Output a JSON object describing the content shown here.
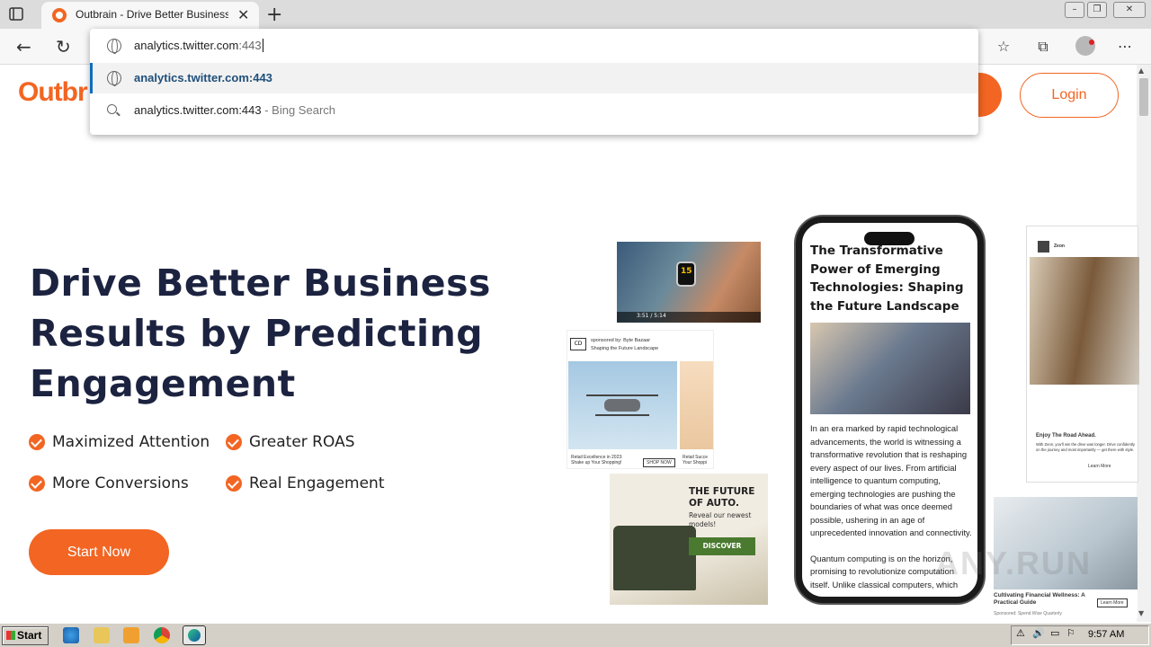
{
  "browser": {
    "tab": {
      "title": "Outbrain - Drive Better Business R"
    },
    "window_controls": {
      "minimize": "–",
      "restore": "❐",
      "close": "✕"
    },
    "address_bar": {
      "typed": "analytics.twitter.com",
      "autocomplete": ":443"
    },
    "suggestions": [
      {
        "text": "analytics.twitter.com:443"
      },
      {
        "text": "analytics.twitter.com:443",
        "suffix": " - Bing Search"
      }
    ]
  },
  "site": {
    "logo": "Outbr",
    "login_label": "Login",
    "hero": {
      "headline": "Drive Better Business Results by Predicting Engagement",
      "features": [
        "Maximized Attention",
        "Greater ROAS",
        "More Conversions",
        "Real Engagement"
      ],
      "cta": "Start Now"
    },
    "phone_article": {
      "title": "The Transformative Power of Emerging Technologies: Shaping the Future Landscape",
      "body": "In an era marked by rapid technological advancements, the world is witnessing a transformative revolution that is reshaping every aspect of our lives. From artificial intelligence to quantum computing, emerging technologies are pushing the boundaries of what was once deemed possible, ushering in an age of unprecedented innovation and connectivity.",
      "body2": "Quantum computing is on the horizon, promising to revolutionize computation itself. Unlike classical computers, which"
    },
    "watch_video": {
      "time": "3:51 / 5:14"
    },
    "drone_ad": {
      "sponsor": "sponsored by: Byte Bazaar",
      "subtitle": "Shaping the Future Landscape",
      "caption": "Retail Excellence in 2023: Shake up Your Shopping!",
      "button": "SHOP NOW",
      "caption2": "Retail Succe Your Shoppi"
    },
    "auto_ad": {
      "title": "THE FUTURE OF AUTO.",
      "subtitle": "Reveal our newest models!",
      "button": "DISCOVER"
    },
    "car_ad": {
      "brand": "Zeon",
      "title": "Enjoy The Road Ahead.",
      "text": "With Zeon, you'll win the drive was longer. Drive confidently on the journey and most importantly — get there with style.",
      "button": "Learn More"
    },
    "finance_ad": {
      "title": "Cultivating Financial Wellness: A Practical Guide",
      "sponsor": "Sponsored: Spend Wise Quarterly",
      "button": "Learn More"
    }
  },
  "taskbar": {
    "start_label": "Start",
    "clock": "9:57 AM"
  },
  "watermark": "ANY.RUN"
}
